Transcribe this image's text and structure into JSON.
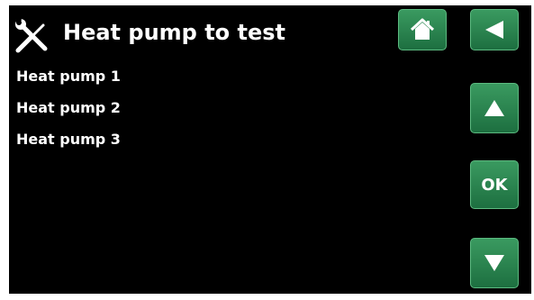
{
  "header": {
    "title": "Heat pump to test",
    "icon": "tools-icon"
  },
  "list": {
    "items": [
      {
        "label": "Heat pump 1"
      },
      {
        "label": "Heat pump 2"
      },
      {
        "label": "Heat pump 3"
      }
    ]
  },
  "buttons": {
    "home_icon": "home-icon",
    "back_icon": "back-arrow-icon",
    "up_icon": "up-arrow-icon",
    "ok_label": "OK",
    "down_icon": "down-arrow-icon"
  },
  "colors": {
    "background": "#000000",
    "text": "#ffffff",
    "button": "#2a8450"
  }
}
